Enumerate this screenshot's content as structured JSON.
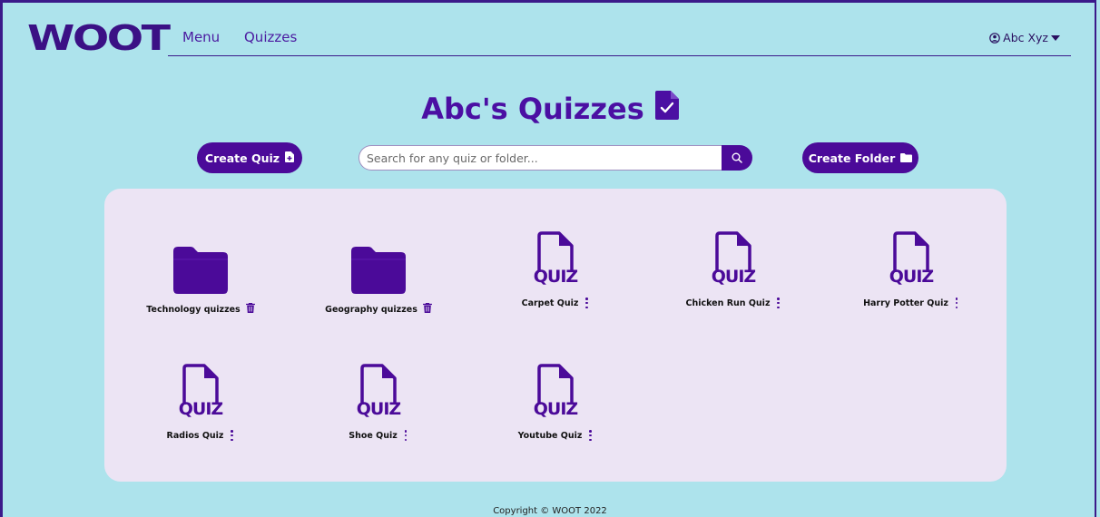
{
  "brand": {
    "logo": "WOOT"
  },
  "nav": {
    "menu": "Menu",
    "quizzes": "Quizzes"
  },
  "user": {
    "name": "Abc Xyz"
  },
  "page": {
    "title": "Abc's Quizzes"
  },
  "actions": {
    "create_quiz": "Create Quiz",
    "create_folder": "Create Folder"
  },
  "search": {
    "placeholder": "Search for any quiz or folder...",
    "value": ""
  },
  "items": [
    {
      "type": "folder",
      "label": "Technology quizzes",
      "action_icon": "trash-icon"
    },
    {
      "type": "folder",
      "label": "Geography quizzes",
      "action_icon": "trash-icon"
    },
    {
      "type": "quiz",
      "label": "Carpet Quiz",
      "action_icon": "kebab-menu-icon"
    },
    {
      "type": "quiz",
      "label": "Chicken Run Quiz",
      "action_icon": "kebab-menu-icon"
    },
    {
      "type": "quiz",
      "label": "Harry Potter Quiz",
      "action_icon": "kebab-menu-icon"
    },
    {
      "type": "quiz",
      "label": "Radios Quiz",
      "action_icon": "kebab-menu-icon"
    },
    {
      "type": "quiz",
      "label": "Shoe Quiz",
      "action_icon": "kebab-menu-icon"
    },
    {
      "type": "quiz",
      "label": "Youtube Quiz",
      "action_icon": "kebab-menu-icon"
    }
  ],
  "quiz_icon_text": "QUIZ",
  "footer": {
    "text": "Copyright © WOOT 2022"
  },
  "colors": {
    "background": "#ade3ec",
    "accent": "#4b0a99",
    "panel": "#ece4f4"
  }
}
